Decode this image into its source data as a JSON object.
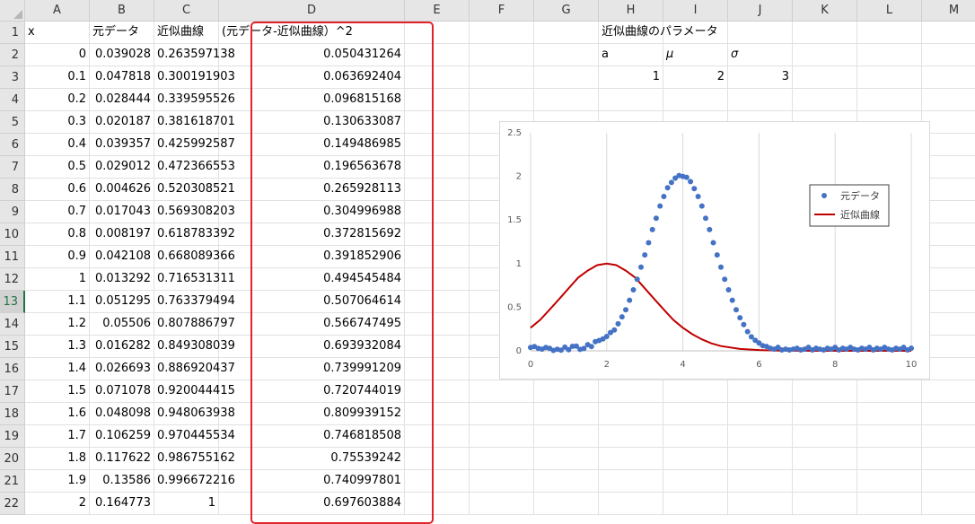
{
  "columns": [
    "A",
    "B",
    "C",
    "D",
    "E",
    "F",
    "G",
    "H",
    "I",
    "J",
    "K",
    "L",
    "M"
  ],
  "rows": [
    "1",
    "2",
    "3",
    "4",
    "5",
    "6",
    "7",
    "8",
    "9",
    "10",
    "11",
    "12",
    "13",
    "14",
    "15",
    "16",
    "17",
    "18",
    "19",
    "20",
    "21",
    "22"
  ],
  "cells": {
    "A1": "x",
    "B1": "元データ",
    "C1": "近似曲線",
    "D1": "(元データ-近似曲線）^2",
    "H1": "近似曲線のパラメータ",
    "H2": "a",
    "I2": "μ",
    "J2": "σ",
    "H3": "1",
    "I3": "2",
    "J3": "3",
    "A2": "0",
    "B2": "0.039028",
    "C2": "0.263597138",
    "D2": "0.050431264",
    "A3": "0.1",
    "B3": "0.047818",
    "C3": "0.300191903",
    "D3": "0.063692404",
    "A4": "0.2",
    "B4": "0.028444",
    "C4": "0.339595526",
    "D4": "0.096815168",
    "A5": "0.3",
    "B5": "0.020187",
    "C5": "0.381618701",
    "D5": "0.130633087",
    "A6": "0.4",
    "B6": "0.039357",
    "C6": "0.425992587",
    "D6": "0.149486985",
    "A7": "0.5",
    "B7": "0.029012",
    "C7": "0.472366553",
    "D7": "0.196563678",
    "A8": "0.6",
    "B8": "0.004626",
    "C8": "0.520308521",
    "D8": "0.265928113",
    "A9": "0.7",
    "B9": "0.017043",
    "C9": "0.569308203",
    "D9": "0.304996988",
    "A10": "0.8",
    "B10": "0.008197",
    "C10": "0.618783392",
    "D10": "0.372815692",
    "A11": "0.9",
    "B11": "0.042108",
    "C11": "0.668089366",
    "D11": "0.391852906",
    "A12": "1",
    "B12": "0.013292",
    "C12": "0.716531311",
    "D12": "0.494545484",
    "A13": "1.1",
    "B13": "0.051295",
    "C13": "0.763379494",
    "D13": "0.507064614",
    "A14": "1.2",
    "B14": "0.05506",
    "C14": "0.807886797",
    "D14": "0.566747495",
    "A15": "1.3",
    "B15": "0.016282",
    "C15": "0.849308039",
    "D15": "0.693932084",
    "A16": "1.4",
    "B16": "0.026693",
    "C16": "0.886920437",
    "D16": "0.739991209",
    "A17": "1.5",
    "B17": "0.071078",
    "C17": "0.920044415",
    "D17": "0.720744019",
    "A18": "1.6",
    "B18": "0.048098",
    "C18": "0.948063938",
    "D18": "0.809939152",
    "A19": "1.7",
    "B19": "0.106259",
    "C19": "0.970445534",
    "D19": "0.746818508",
    "A20": "1.8",
    "B20": "0.117622",
    "C20": "0.986755162",
    "D20": "0.75539242",
    "A21": "1.9",
    "B21": "0.13586",
    "C21": "0.996672216",
    "D21": "0.740997801",
    "A22": "2",
    "B22": "0.164773",
    "C22": "1",
    "D22": "0.697603884"
  },
  "selected_row": "13",
  "highlight_color": "#e0242a",
  "chart_data": {
    "type": "scatter",
    "xlim": [
      0,
      10
    ],
    "ylim": [
      0,
      2.5
    ],
    "x_ticks": [
      "0",
      "2",
      "4",
      "6",
      "8",
      "10"
    ],
    "y_ticks": [
      "0",
      "0.5",
      "1",
      "1.5",
      "2",
      "2.5"
    ],
    "grid": "vertical",
    "legend": "right",
    "series": [
      {
        "name": "元データ",
        "kind": "markers",
        "color": "#4472c4",
        "x": [
          0,
          0.1,
          0.2,
          0.3,
          0.4,
          0.5,
          0.6,
          0.7,
          0.8,
          0.9,
          1.0,
          1.1,
          1.2,
          1.3,
          1.4,
          1.5,
          1.6,
          1.7,
          1.8,
          1.9,
          2.0,
          2.1,
          2.2,
          2.3,
          2.4,
          2.5,
          2.6,
          2.7,
          2.8,
          2.9,
          3.0,
          3.1,
          3.2,
          3.3,
          3.4,
          3.5,
          3.6,
          3.7,
          3.8,
          3.9,
          4.0,
          4.1,
          4.2,
          4.3,
          4.4,
          4.5,
          4.6,
          4.7,
          4.8,
          4.9,
          5.0,
          5.1,
          5.2,
          5.3,
          5.4,
          5.5,
          5.6,
          5.7,
          5.8,
          5.9,
          6.0,
          6.1,
          6.2,
          6.3,
          6.4,
          6.5,
          6.6,
          6.7,
          6.8,
          6.9,
          7.0,
          7.1,
          7.2,
          7.3,
          7.4,
          7.5,
          7.6,
          7.7,
          7.8,
          7.9,
          8.0,
          8.1,
          8.2,
          8.3,
          8.4,
          8.5,
          8.6,
          8.7,
          8.8,
          8.9,
          9.0,
          9.1,
          9.2,
          9.3,
          9.4,
          9.5,
          9.6,
          9.7,
          9.8,
          9.9,
          10.0
        ],
        "y": [
          0.039,
          0.048,
          0.028,
          0.02,
          0.039,
          0.029,
          0.005,
          0.017,
          0.008,
          0.042,
          0.013,
          0.051,
          0.055,
          0.016,
          0.027,
          0.071,
          0.048,
          0.106,
          0.118,
          0.136,
          0.165,
          0.21,
          0.24,
          0.31,
          0.39,
          0.47,
          0.58,
          0.7,
          0.82,
          0.96,
          1.1,
          1.24,
          1.39,
          1.52,
          1.66,
          1.77,
          1.87,
          1.93,
          1.98,
          2.01,
          2.0,
          1.99,
          1.94,
          1.86,
          1.77,
          1.66,
          1.52,
          1.39,
          1.24,
          1.1,
          0.96,
          0.82,
          0.7,
          0.58,
          0.47,
          0.38,
          0.3,
          0.22,
          0.16,
          0.12,
          0.09,
          0.06,
          0.05,
          0.03,
          0.02,
          0.04,
          0.01,
          0.02,
          0.01,
          0.02,
          0.03,
          0.01,
          0.02,
          0.04,
          0.01,
          0.03,
          0.02,
          0.01,
          0.03,
          0.02,
          0.04,
          0.01,
          0.03,
          0.02,
          0.04,
          0.02,
          0.01,
          0.03,
          0.02,
          0.04,
          0.01,
          0.03,
          0.02,
          0.04,
          0.02,
          0.01,
          0.03,
          0.02,
          0.04,
          0.01,
          0.03
        ]
      },
      {
        "name": "近似曲線",
        "kind": "line",
        "color": "#c00000",
        "x": [
          0,
          0.25,
          0.5,
          0.75,
          1.0,
          1.25,
          1.5,
          1.75,
          2.0,
          2.25,
          2.5,
          2.75,
          3.0,
          3.25,
          3.5,
          3.75,
          4.0,
          4.25,
          4.5,
          4.75,
          5.0,
          5.5,
          6.0,
          6.5,
          7.0,
          7.5,
          8.0,
          9.0,
          10.0
        ],
        "y": [
          0.264,
          0.355,
          0.472,
          0.594,
          0.717,
          0.84,
          0.92,
          0.983,
          1.0,
          0.983,
          0.92,
          0.84,
          0.717,
          0.594,
          0.472,
          0.355,
          0.264,
          0.19,
          0.132,
          0.085,
          0.055,
          0.022,
          0.009,
          0.003,
          0.001,
          0.0,
          0.0,
          0.0,
          0.0
        ]
      }
    ]
  }
}
